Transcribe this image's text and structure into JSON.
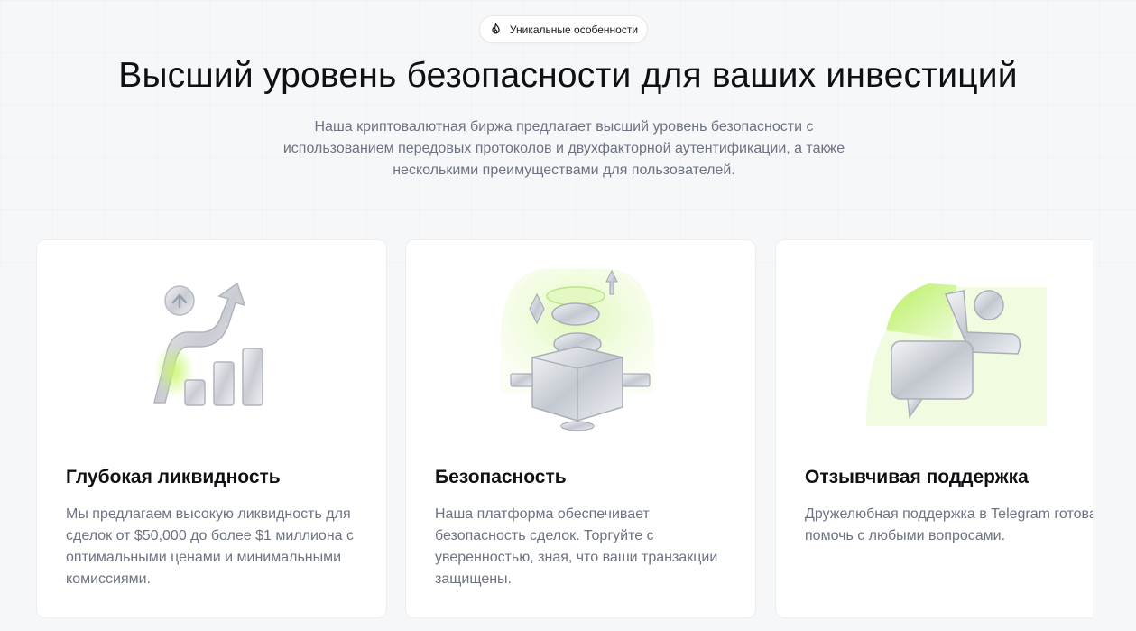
{
  "badge": {
    "label": "Уникальные особенности",
    "icon": "flame-icon"
  },
  "hero": {
    "title": "Высший уровень безопасности для ваших инвестиций",
    "subtitle": "Наша криптовалютная биржа предлагает высший уровень безопасности с использованием передовых протоколов и двухфакторной аутентификации, а также несколькими преимуществами для пользователей."
  },
  "cards": [
    {
      "title": "Глубокая ликвидность",
      "text": "Мы предлагаем высокую ликвидность для сделок от $50,000 до более $1 миллиона с оптимальными ценами и минимальными комиссиями.",
      "icon": "growth-chart-icon"
    },
    {
      "title": "Безопасность",
      "text": "Наша платформа обеспечивает безопасность сделок. Торгуйте с уверенностью, зная, что ваши транзакции защищены.",
      "icon": "coin-box-icon"
    },
    {
      "title": "Отзывчивая поддержка",
      "text": "Дружелюбная поддержка в Telegram готова помочь с любыми вопросами.",
      "icon": "support-chat-icon"
    }
  ],
  "colors": {
    "accent": "#c8f56a",
    "text": "#0e1014",
    "muted": "#6b7282"
  }
}
